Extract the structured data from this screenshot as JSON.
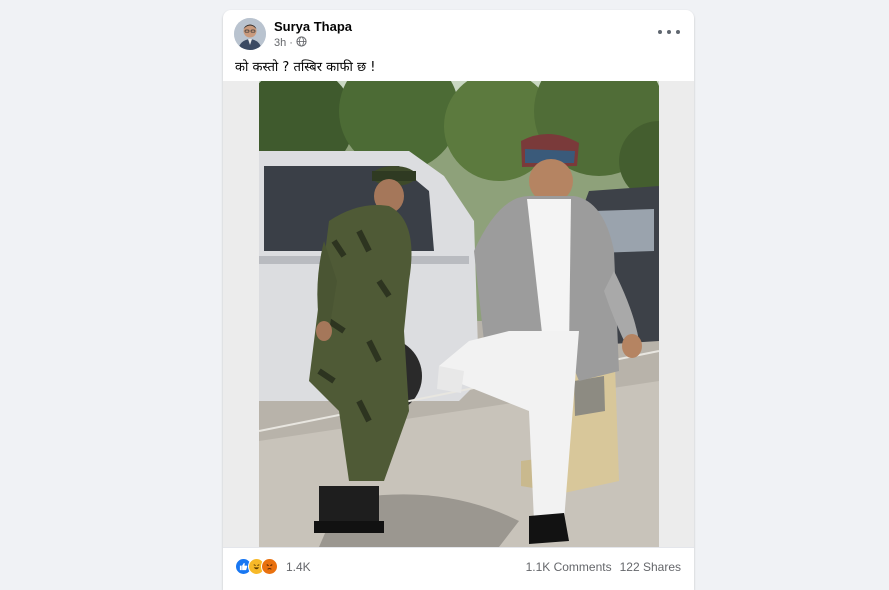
{
  "post": {
    "author": "Surya Thapa",
    "time": "3h",
    "separator": "·",
    "text": "को कस्तो ? तस्बिर काफी छ !"
  },
  "reactions": {
    "icons": [
      "like-icon",
      "haha-icon",
      "angry-icon"
    ],
    "count": "1.4K"
  },
  "stats": {
    "comments": "1.1K Comments",
    "shares": "122 Shares"
  },
  "colors": {
    "like": "#1877f2",
    "haha": "#f7b928",
    "angry": "#e9710f",
    "page_bg": "#f0f2f5"
  }
}
